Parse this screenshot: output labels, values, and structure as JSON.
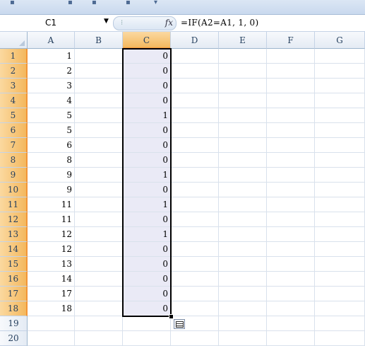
{
  "name_box": {
    "value": "C1"
  },
  "formula_bar": {
    "formula": "=IF(A2=A1, 1, 0)",
    "fx_label": "fx"
  },
  "columns": [
    "A",
    "B",
    "C",
    "D",
    "E",
    "F",
    "G"
  ],
  "selected_column": "C",
  "rows": [
    {
      "num": "1",
      "a": "1",
      "c": "0"
    },
    {
      "num": "2",
      "a": "2",
      "c": "0"
    },
    {
      "num": "3",
      "a": "3",
      "c": "0"
    },
    {
      "num": "4",
      "a": "4",
      "c": "0"
    },
    {
      "num": "5",
      "a": "5",
      "c": "1"
    },
    {
      "num": "6",
      "a": "5",
      "c": "0"
    },
    {
      "num": "7",
      "a": "6",
      "c": "0"
    },
    {
      "num": "8",
      "a": "8",
      "c": "0"
    },
    {
      "num": "9",
      "a": "9",
      "c": "1"
    },
    {
      "num": "10",
      "a": "9",
      "c": "0"
    },
    {
      "num": "11",
      "a": "11",
      "c": "1"
    },
    {
      "num": "12",
      "a": "11",
      "c": "0"
    },
    {
      "num": "13",
      "a": "12",
      "c": "1"
    },
    {
      "num": "14",
      "a": "12",
      "c": "0"
    },
    {
      "num": "15",
      "a": "13",
      "c": "0"
    },
    {
      "num": "16",
      "a": "14",
      "c": "0"
    },
    {
      "num": "17",
      "a": "17",
      "c": "0"
    },
    {
      "num": "18",
      "a": "18",
      "c": "0"
    },
    {
      "num": "19",
      "a": "",
      "c": ""
    },
    {
      "num": "20",
      "a": "",
      "c": ""
    }
  ],
  "colors": {
    "selection_fill": "#eaeaf6",
    "header_highlight": "#f4b85e"
  }
}
